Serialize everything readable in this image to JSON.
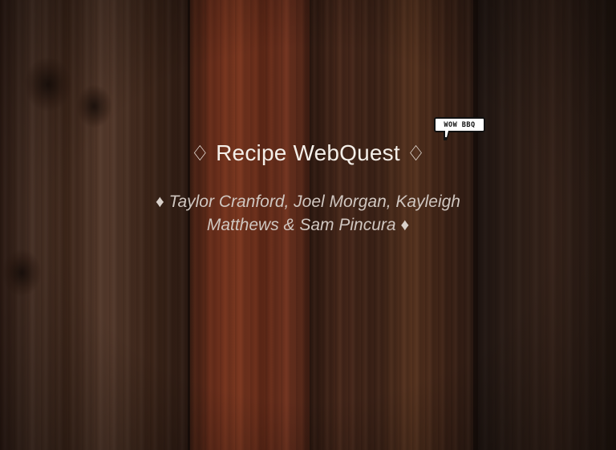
{
  "slide": {
    "title": {
      "prefix_symbol": "♢",
      "text": "Recipe WebQuest",
      "suffix_symbol": "♢"
    },
    "subtitle": {
      "prefix_symbol": "♦",
      "text": "Taylor Cranford, Joel Morgan, Kayleigh Matthews & Sam Pincura",
      "suffix_symbol": "♦"
    },
    "sticker": {
      "text": "WOW BBQ",
      "icon": "speech-bubble-icon"
    },
    "background": {
      "texture": "wood-planks",
      "colors": [
        "#3b2418",
        "#6a2e1b",
        "#46271a",
        "#2c1d16"
      ]
    },
    "colors": {
      "title_text": "#f4efe9",
      "subtitle_text": "#cfc6c0"
    }
  }
}
